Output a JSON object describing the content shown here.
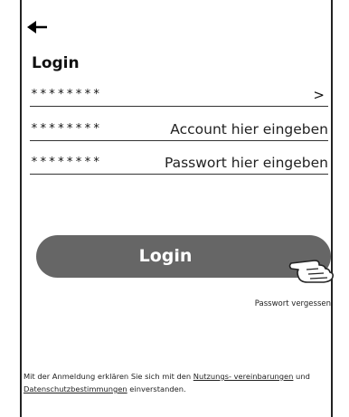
{
  "header": {
    "back_icon": "arrow-left-icon",
    "title": "Login"
  },
  "rows": [
    {
      "mask": "********",
      "trailing": ">"
    },
    {
      "mask": "********",
      "placeholder": "Account hier eingeben"
    },
    {
      "mask": "********",
      "placeholder": "Passwort hier eingeben"
    }
  ],
  "login_button": {
    "label": "Login",
    "pointer_icon": "pointing-hand-icon",
    "color": "#666666"
  },
  "forgot_password": "Passwort vergessen",
  "terms": {
    "prefix": "Mit der Anmeldung erklären Sie sich mit den ",
    "link1": "Nutzungs- vereinbarungen",
    "middle": " und ",
    "link2": "Datenschutzbestimmungen",
    "suffix": " einverstanden."
  }
}
